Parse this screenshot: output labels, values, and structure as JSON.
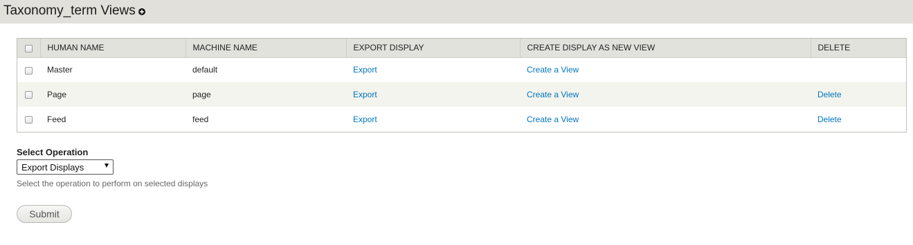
{
  "header": {
    "title": "Taxonomy_term Views",
    "add_icon": "add-circle-icon"
  },
  "table": {
    "columns": [
      "HUMAN NAME",
      "MACHINE NAME",
      "EXPORT DISPLAY",
      "CREATE DISPLAY AS NEW VIEW",
      "DELETE"
    ],
    "rows": [
      {
        "human_name": "Master",
        "machine_name": "default",
        "export": "Export",
        "create": "Create a View",
        "delete": ""
      },
      {
        "human_name": "Page",
        "machine_name": "page",
        "export": "Export",
        "create": "Create a View",
        "delete": "Delete"
      },
      {
        "human_name": "Feed",
        "machine_name": "feed",
        "export": "Export",
        "create": "Create a View",
        "delete": "Delete"
      }
    ]
  },
  "operation": {
    "label": "Select Operation",
    "selected": "Export Displays",
    "description": "Select the operation to perform on selected displays"
  },
  "submit_label": "Submit",
  "colors": {
    "header_bg": "#e1e0db",
    "link": "#0074bd",
    "row_alt": "#f3f4ee"
  }
}
